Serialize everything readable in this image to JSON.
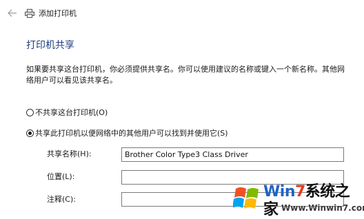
{
  "window": {
    "title": "添加打印机",
    "back_icon": "back-arrow-icon",
    "printer_icon": "printer-icon"
  },
  "section": {
    "heading": "打印机共享",
    "description": "如果要共享这台打印机，你必须提供共享名。你可以使用建议的名称或键入一个新名称。其他网络用户可以看见该共享名。"
  },
  "options": {
    "no_share_label": "不共享这台打印机(O)",
    "share_label": "共享此打印机以便网络中的其他用户可以找到并使用它(S)",
    "selected": "share"
  },
  "fields": {
    "share_name_label": "共享名称(H):",
    "share_name_value": "Brother Color Type3 Class Driver",
    "location_label": "位置(L):",
    "location_value": "",
    "comment_label": "注释(C):",
    "comment_value": ""
  },
  "watermark": {
    "title_w": "Wi",
    "title_n": "n",
    "title_7": "7",
    "title_rest": "系统之家",
    "url": "Www.Winwin7.com"
  },
  "colors": {
    "heading": "#1f3e80",
    "input_border": "#7a7a7a",
    "wm_blue": "#1e64c8",
    "wm_red": "#e63a1a"
  }
}
